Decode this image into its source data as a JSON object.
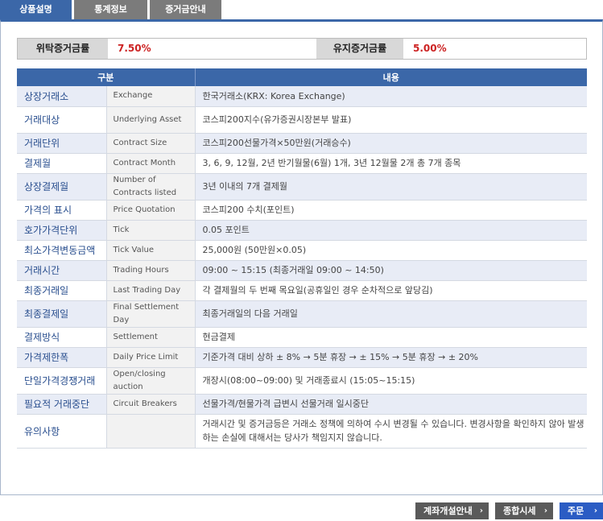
{
  "tabs": [
    "상품설명",
    "통계정보",
    "증거금안내"
  ],
  "margin": {
    "initial_label": "위탁증거금률",
    "initial_value": "7.50%",
    "maintenance_label": "유지증거금률",
    "maintenance_value": "5.00%"
  },
  "table": {
    "headers": [
      "구분",
      "내용"
    ],
    "rows": [
      {
        "ko": "상장거래소",
        "en": "Exchange",
        "content": "한국거래소(KRX: Korea Exchange)"
      },
      {
        "ko": "거래대상",
        "en": "Underlying Asset",
        "content": "코스피200지수(유가증권시장본부 발표)"
      },
      {
        "ko": "거래단위",
        "en": "Contract Size",
        "content": "코스피200선물가격×50만원(거래승수)"
      },
      {
        "ko": "결제월",
        "en": "Contract Month",
        "content": "3, 6, 9, 12월, 2년 반기월물(6월) 1개, 3년 12월물 2개 총 7개 종목"
      },
      {
        "ko": "상장결제월",
        "en": "Number of Contracts listed",
        "content": "3년 이내의 7개 결제월"
      },
      {
        "ko": "가격의 표시",
        "en": "Price Quotation",
        "content": "코스피200 수치(포인트)"
      },
      {
        "ko": "호가가격단위",
        "en": "Tick",
        "content": "0.05 포인트"
      },
      {
        "ko": "최소가격변동금액",
        "en": "Tick Value",
        "content": "25,000원 (50만원×0.05)"
      },
      {
        "ko": "거래시간",
        "en": "Trading Hours",
        "content": "09:00 ~ 15:15 (최종거래일 09:00 ~ 14:50)"
      },
      {
        "ko": "최종거래일",
        "en": "Last Trading Day",
        "content": "각 결제월의 두 번째 목요일(공휴일인 경우 순차적으로 앞당김)"
      },
      {
        "ko": "최종결제일",
        "en": "Final Settlement Day",
        "content": "최종거래일의 다음 거래일"
      },
      {
        "ko": "결제방식",
        "en": "Settlement",
        "content": "현금결제"
      },
      {
        "ko": "가격제한폭",
        "en": "Daily Price Limit",
        "content": "기준가격 대비 상하 ± 8% → 5분 휴장 → ± 15% → 5분 휴장 → ± 20%"
      },
      {
        "ko": "단일가격경쟁거래",
        "en": "Open/closing auction",
        "content": "개장시(08:00~09:00) 및 거래종료시 (15:05~15:15)"
      },
      {
        "ko": "필요적 거래중단",
        "en": "Circuit Breakers",
        "content": "선물가격/현물가격 급변시 선물거래 일시중단"
      },
      {
        "ko": "유의사항",
        "en": "",
        "content": "거래시간 및 증거금등은 거래소 정책에 의하여 수시 변경될 수 있습니다. 변경사항을 확인하지 않아 발생하는 손실에 대해서는 당사가 책임지지 않습니다."
      }
    ]
  },
  "buttons": {
    "account": "계좌개설안내",
    "quote": "종합시세",
    "order": "주문",
    "arrow": "›"
  }
}
